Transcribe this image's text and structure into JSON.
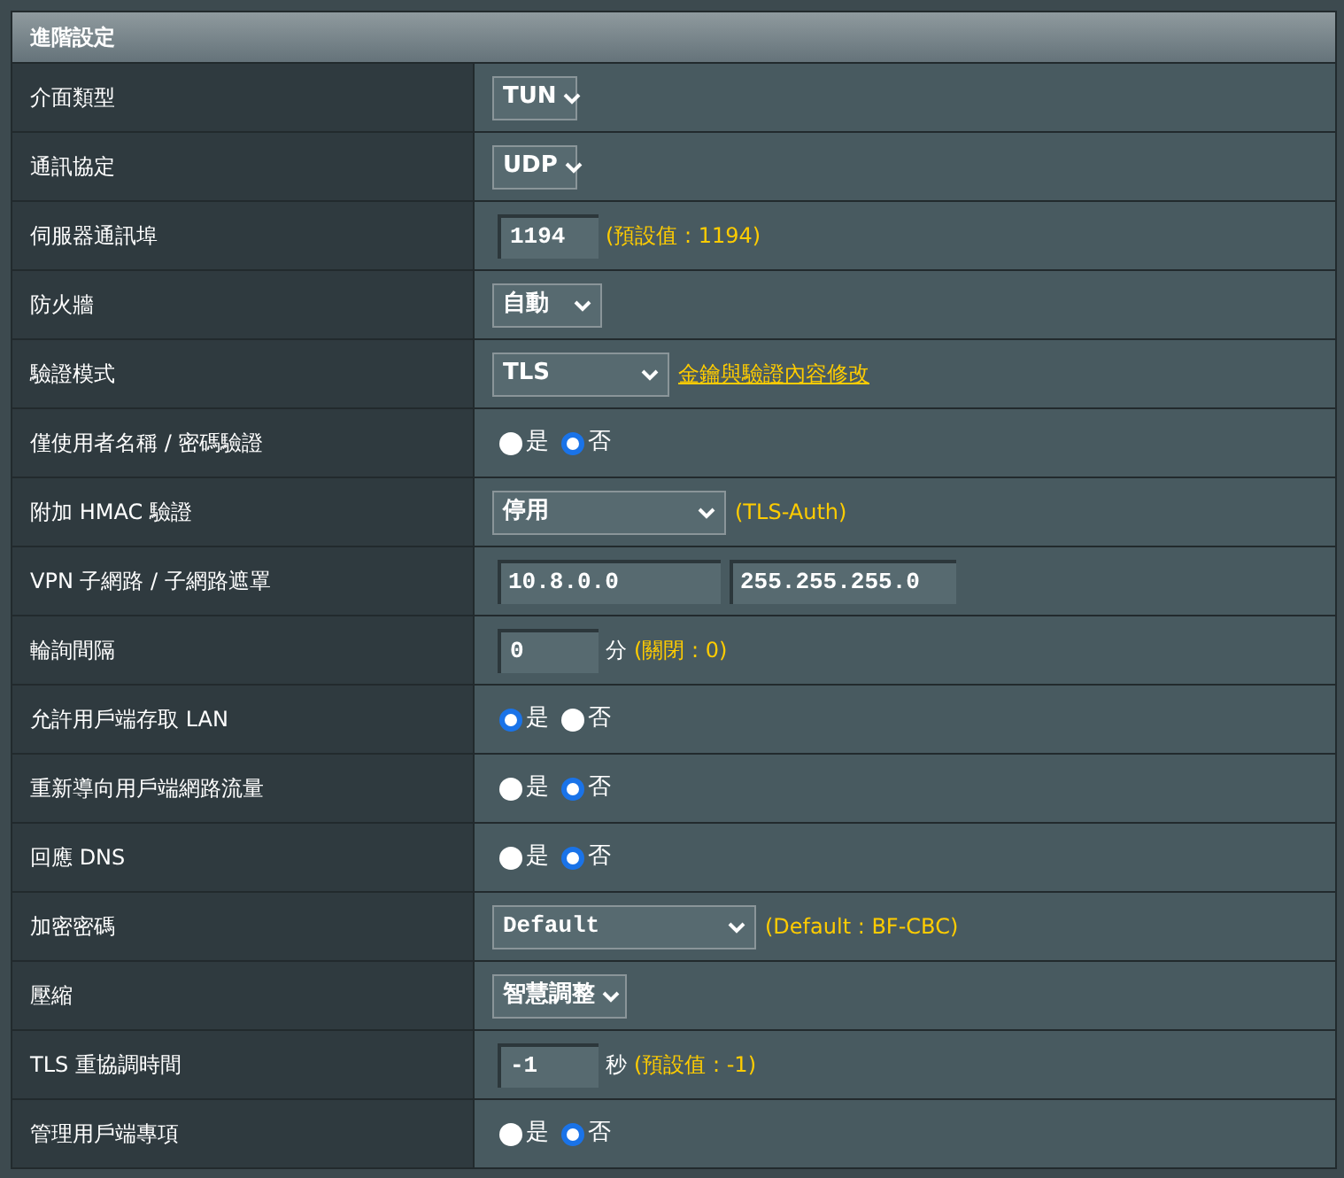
{
  "panel": {
    "title": "進階設定"
  },
  "rows": [
    {
      "label": "介面類型",
      "kind": "select",
      "value": "TUN"
    },
    {
      "label": "通訊協定",
      "kind": "select",
      "value": "UDP"
    },
    {
      "label": "伺服器通訊埠",
      "kind": "input",
      "value": "1194",
      "hint": "(預設值 : 1194)"
    },
    {
      "label": "防火牆",
      "kind": "select",
      "value": "自動"
    },
    {
      "label": "驗證模式",
      "kind": "select",
      "value": "TLS",
      "link": "金鑰與驗證內容修改"
    },
    {
      "label": "僅使用者名稱 / 密碼驗證",
      "kind": "radio",
      "options": [
        {
          "label": "是",
          "selected": false
        },
        {
          "label": "否",
          "selected": true
        }
      ]
    },
    {
      "label": "附加 HMAC 驗證",
      "kind": "select",
      "value": "停用",
      "hint": "(TLS-Auth)"
    },
    {
      "label": "VPN 子網路 / 子網路遮罩",
      "kind": "inputs",
      "values": [
        "10.8.0.0",
        "255.255.255.0"
      ]
    },
    {
      "label": "輪詢間隔",
      "kind": "input",
      "value": "0",
      "unit": "分",
      "hint": "(關閉 : 0)"
    },
    {
      "label": "允許用戶端存取 LAN",
      "kind": "radio",
      "options": [
        {
          "label": "是",
          "selected": true
        },
        {
          "label": "否",
          "selected": false
        }
      ]
    },
    {
      "label": "重新導向用戶端網路流量",
      "kind": "radio",
      "options": [
        {
          "label": "是",
          "selected": false
        },
        {
          "label": "否",
          "selected": true
        }
      ]
    },
    {
      "label": "回應 DNS",
      "kind": "radio",
      "options": [
        {
          "label": "是",
          "selected": false
        },
        {
          "label": "否",
          "selected": true
        }
      ]
    },
    {
      "label": "加密密碼",
      "kind": "select",
      "value": "Default",
      "mono": true,
      "hint": "(Default : BF-CBC)"
    },
    {
      "label": "壓縮",
      "kind": "select",
      "value": "智慧調整"
    },
    {
      "label": "TLS 重協調時間",
      "kind": "input",
      "value": "-1",
      "unit": "秒",
      "hint": "(預設值 : -1)"
    },
    {
      "label": "管理用戶端專項",
      "kind": "radio",
      "options": [
        {
          "label": "是",
          "selected": false
        },
        {
          "label": "否",
          "selected": true
        }
      ]
    }
  ]
}
